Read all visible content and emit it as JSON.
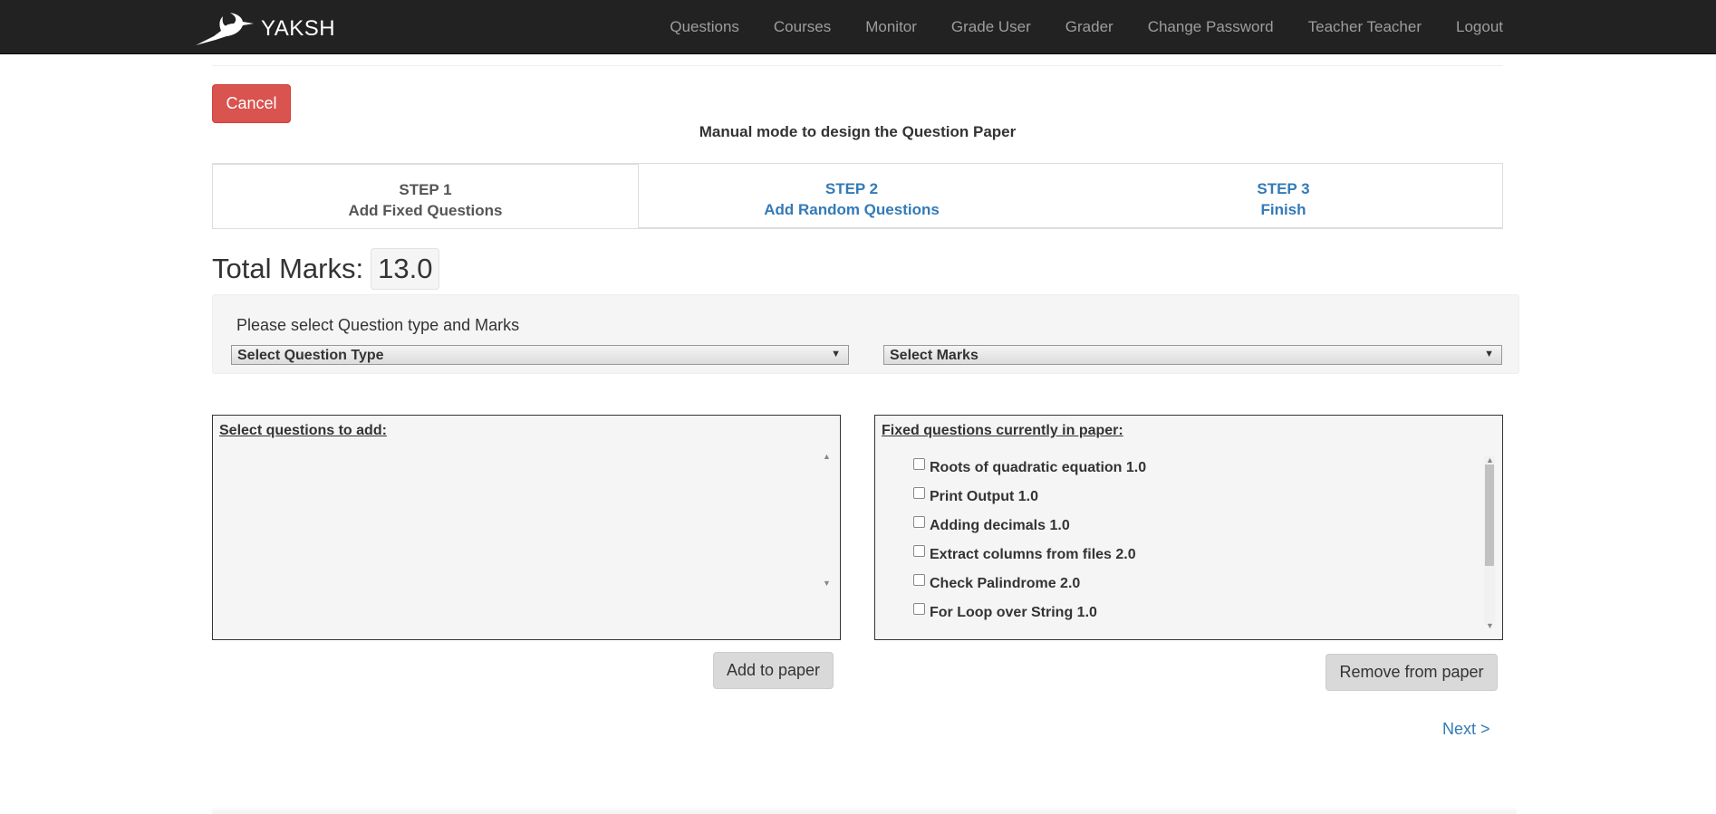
{
  "navbar": {
    "brand": "YAKSH",
    "items": [
      "Questions",
      "Courses",
      "Monitor",
      "Grade User",
      "Grader",
      "Change Password",
      "Teacher Teacher",
      "Logout"
    ]
  },
  "cancel_label": "Cancel",
  "heading": "Manual mode to design the Question Paper",
  "steps": [
    {
      "step": "STEP 1",
      "label": "Add Fixed Questions",
      "active": true
    },
    {
      "step": "STEP 2",
      "label": "Add Random Questions",
      "active": false
    },
    {
      "step": "STEP 3",
      "label": "Finish",
      "active": false
    }
  ],
  "total": {
    "label": "Total Marks:",
    "value": "13.0"
  },
  "filters": {
    "label": "Please select Question type and Marks",
    "question_type": "Select Question Type",
    "marks": "Select Marks"
  },
  "available": {
    "title": "Select questions to add:",
    "items": []
  },
  "fixed": {
    "title": "Fixed questions currently in paper:",
    "items": [
      "Roots of quadratic equation 1.0",
      "Print Output 1.0",
      "Adding decimals 1.0",
      "Extract columns from files 2.0",
      "Check Palindrome 2.0",
      "For Loop over String 1.0"
    ]
  },
  "add_label": "Add to paper",
  "remove_label": "Remove from paper",
  "next_label": "Next >",
  "colors": {
    "navbar": "#222222",
    "danger": "#d9534f",
    "link": "#337ab7"
  }
}
